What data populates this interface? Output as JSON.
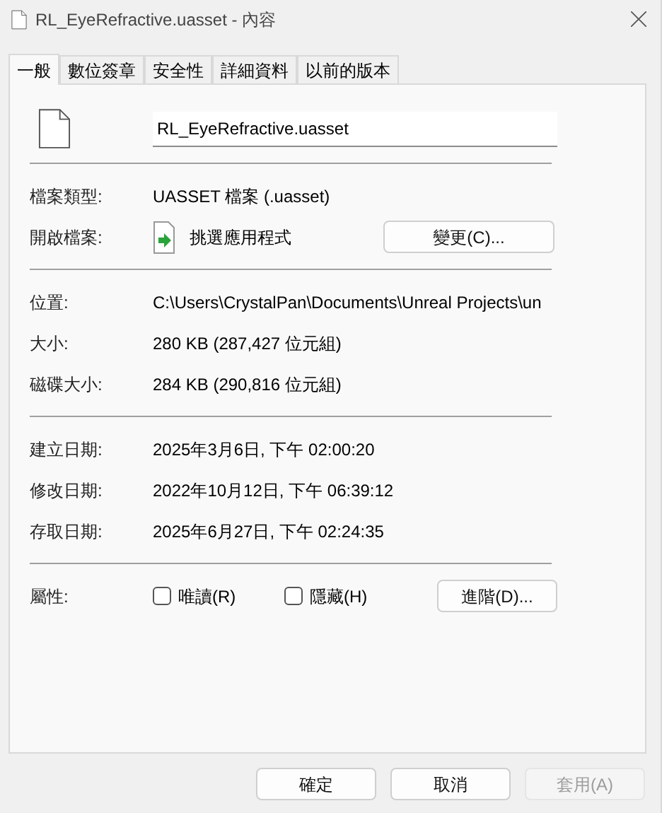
{
  "window": {
    "title": "RL_EyeRefractive.uasset - 內容"
  },
  "tabs": [
    {
      "label": "一般",
      "selected": true
    },
    {
      "label": "數位簽章",
      "selected": false
    },
    {
      "label": "安全性",
      "selected": false
    },
    {
      "label": "詳細資料",
      "selected": false
    },
    {
      "label": "以前的版本",
      "selected": false
    }
  ],
  "file_name": "RL_EyeRefractive.uasset",
  "type_row": {
    "label": "檔案類型:",
    "value": "UASSET 檔案 (.uasset)"
  },
  "open_with": {
    "label": "開啟檔案:",
    "value": "挑選應用程式",
    "button": "變更(C)..."
  },
  "location_rows": [
    {
      "label": "位置:",
      "value": "C:\\Users\\CrystalPan\\Documents\\Unreal Projects\\un"
    },
    {
      "label": "大小:",
      "value": "280 KB (287,427 位元組)"
    },
    {
      "label": "磁碟大小:",
      "value": "284 KB (290,816 位元組)"
    }
  ],
  "date_rows": [
    {
      "label": "建立日期:",
      "value": "2025年3月6日, 下午 02:00:20"
    },
    {
      "label": "修改日期:",
      "value": "2022年10月12日, 下午 06:39:12"
    },
    {
      "label": "存取日期:",
      "value": "2025年6月27日, 下午 02:24:35"
    }
  ],
  "attributes": {
    "label": "屬性:",
    "options": [
      {
        "label": "唯讀(R)",
        "checked": false
      },
      {
        "label": "隱藏(H)",
        "checked": false
      }
    ],
    "button": "進階(D)..."
  },
  "buttons": [
    {
      "label": "確定",
      "disabled": false
    },
    {
      "label": "取消",
      "disabled": false
    },
    {
      "label": "套用(A)",
      "disabled": true
    }
  ]
}
